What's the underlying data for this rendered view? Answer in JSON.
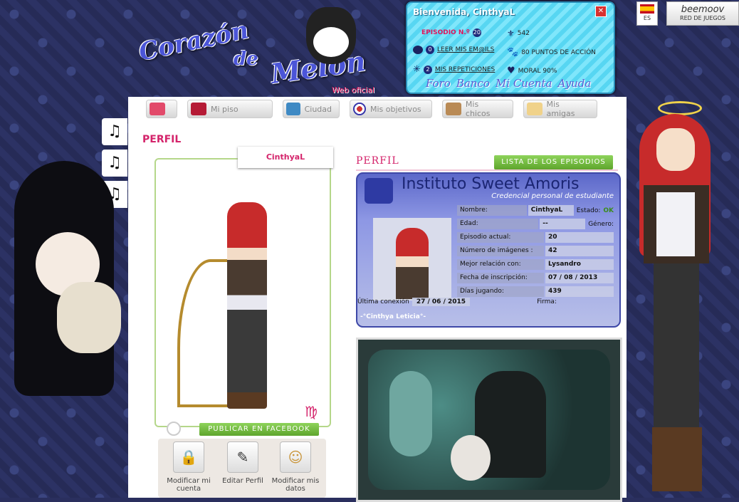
{
  "logo": {
    "line1": "Corazón",
    "line2": "de",
    "line3": "Melón",
    "tagline": "Web oficial"
  },
  "welcome": {
    "title": "Bienvenida, CinthyaL",
    "episode_label": "EPISODIO N.º",
    "episode_number": "20",
    "mail_count": "0",
    "mail_link": "LEER MIS EM@ILS",
    "repeat_count": "2",
    "repeat_link": "MIS REPETICIONES",
    "dollars": "542",
    "action_points": "80 PUNTOS DE ACCIÓN",
    "moral": "MORAL 90%"
  },
  "subnav": [
    "Foro",
    "Banco",
    "Mi Cuenta",
    "Ayuda"
  ],
  "lang": {
    "code": "ES"
  },
  "network": {
    "brand": "beemoov",
    "label": "RED DE JUEGOS"
  },
  "tabs": [
    {
      "label": ""
    },
    {
      "label": "Mi piso"
    },
    {
      "label": "Ciudad"
    },
    {
      "label": "Mis objetivos"
    },
    {
      "label": "Mis chicos"
    },
    {
      "label": "Mis amigas"
    }
  ],
  "music_icons": [
    "♫",
    "♫",
    "♫"
  ],
  "profile": {
    "heading": "PERFIL",
    "name": "CinthyaL",
    "zodiac": "♍",
    "facebook_button": "PUBLICAR EN FACEBOOK",
    "actions": [
      {
        "label": "Modificar mi cuenta",
        "icon": "lock-icon"
      },
      {
        "label": "Editar Perfil",
        "icon": "pen-icon"
      },
      {
        "label": "Modificar mis datos",
        "icon": "avatar-icon"
      }
    ]
  },
  "right": {
    "heading": "PERFIL",
    "episodes_button": "LISTA DE LOS EPISODIOS",
    "card": {
      "school": "Instituto Sweet Amoris",
      "credential": "Credencial personal de estudiante",
      "fields": [
        {
          "label": "Nombre:",
          "value": "CinthyaL"
        },
        {
          "label": "Edad:",
          "value": "--"
        },
        {
          "label": "Episodio actual:",
          "value": "20"
        },
        {
          "label": "Número de imágenes :",
          "value": "42"
        },
        {
          "label": "Mejor relación con:",
          "value": "Lysandro"
        },
        {
          "label": "Fecha de inscripción:",
          "value": "07 / 08 / 2013"
        },
        {
          "label": "Días jugando:",
          "value": "439"
        }
      ],
      "estado_label": "Estado:",
      "estado_value": "OK",
      "genero_label": "Género:",
      "last_label": "Última conexión",
      "last_value": "27 / 06 / 2015",
      "firma_label": "Firma:",
      "nickname": "-°Cinthya Leticia°-"
    }
  },
  "colors": {
    "accent_pink": "#d4246b",
    "green_button": "#6fbf3b",
    "card_blue": "#5c68c9"
  }
}
